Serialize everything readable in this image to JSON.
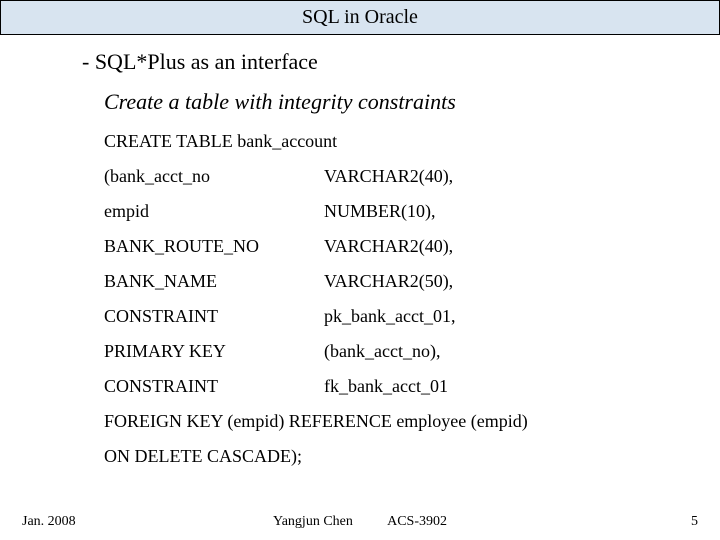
{
  "header": {
    "title": "SQL in Oracle"
  },
  "bullet": {
    "text": "-  SQL*Plus as an interface"
  },
  "subhead": {
    "text": "Create a table with integrity constraints"
  },
  "code": {
    "line1": "CREATE TABLE bank_account",
    "rows": [
      {
        "c1": "(bank_acct_no",
        "c2": "VARCHAR2(40),"
      },
      {
        "c1": "empid",
        "c2": "NUMBER(10),"
      },
      {
        "c1": "BANK_ROUTE_NO",
        "c2": "VARCHAR2(40),"
      },
      {
        "c1": "BANK_NAME",
        "c2": "VARCHAR2(50),"
      },
      {
        "c1": "CONSTRAINT",
        "c2": "pk_bank_acct_01,"
      },
      {
        "c1": "PRIMARY KEY",
        "c2": "(bank_acct_no),"
      },
      {
        "c1": "CONSTRAINT",
        "c2": "fk_bank_acct_01"
      }
    ],
    "line_fk": "FOREIGN KEY (empid) REFERENCE employee (empid)",
    "line_end": "ON DELETE CASCADE);"
  },
  "footer": {
    "left": "Jan. 2008",
    "center": "Yangjun Chen          ACS-3902",
    "right": "5"
  }
}
